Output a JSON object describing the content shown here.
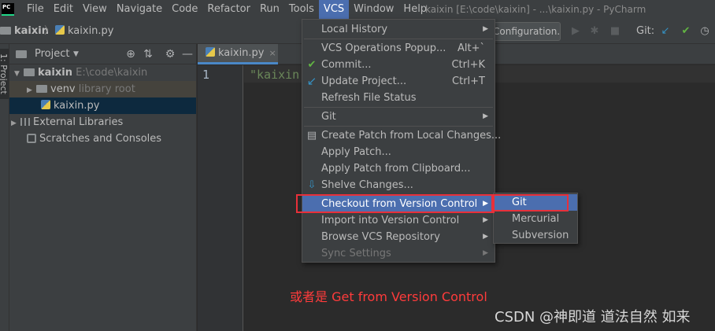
{
  "menubar": {
    "logo": "PC",
    "items": [
      "File",
      "Edit",
      "View",
      "Navigate",
      "Code",
      "Refactor",
      "Run",
      "Tools",
      "VCS",
      "Window",
      "Help"
    ],
    "active": "VCS"
  },
  "window_title": "kaixin [E:\\code\\kaixin] - ...\\kaixin.py - PyCharm",
  "navbar": {
    "breadcrumb_folder": "kaixin",
    "breadcrumb_sep": "〉",
    "breadcrumb_file": "kaixin.py",
    "config_button": "Configuration...",
    "git_label": "Git:",
    "icons": [
      "run-icon",
      "debug-icon",
      "stop-icon",
      "git-update-icon",
      "git-commit-icon",
      "git-history-icon"
    ]
  },
  "side_stripe": {
    "label": "1: Project"
  },
  "project_panel": {
    "title": "Project",
    "header_icons": [
      "dropdown-icon",
      "locate-icon",
      "collapse-icon",
      "settings-icon",
      "hide-icon"
    ],
    "tree": {
      "root_name": "kaixin",
      "root_path": "E:\\code\\kaixin",
      "venv_name": "venv",
      "venv_note": "library root",
      "file_name": "kaixin.py",
      "ext_libs": "External Libraries",
      "scratches": "Scratches and Consoles"
    }
  },
  "editor": {
    "tab_label": "kaixin.py",
    "tab_close": "×",
    "line_number": "1",
    "code": "\"kaixin"
  },
  "vcs_menu": {
    "local_history": "Local History",
    "vcs_popup": "VCS Operations Popup...",
    "vcs_popup_shortcut": "Alt+`",
    "commit": "Commit...",
    "commit_shortcut": "Ctrl+K",
    "update": "Update Project...",
    "update_shortcut": "Ctrl+T",
    "refresh": "Refresh File Status",
    "git": "Git",
    "create_patch": "Create Patch from Local Changes...",
    "apply_patch": "Apply Patch...",
    "apply_clipboard": "Apply Patch from Clipboard...",
    "shelve": "Shelve Changes...",
    "checkout": "Checkout from Version Control",
    "import": "Import into Version Control",
    "browse": "Browse VCS Repository",
    "sync": "Sync Settings"
  },
  "checkout_submenu": [
    "Git",
    "Mercurial",
    "Subversion"
  ],
  "annotation": "或者是  Get from Version Control",
  "watermark": "CSDN @神即道 道法自然 如来",
  "colors": {
    "accent": "#4b6eaf",
    "highlight_box": "#e8303a",
    "annotation_text": "#ff3b3b",
    "commit_check": "#62b543",
    "update_arrow": "#3592c4"
  }
}
